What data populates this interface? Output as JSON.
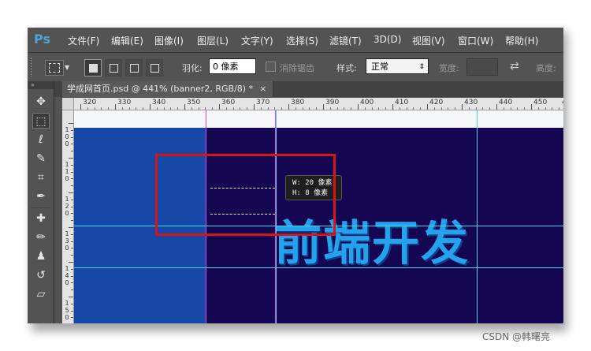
{
  "app": {
    "logo": "Ps"
  },
  "menu": [
    {
      "label": "文件(F)"
    },
    {
      "label": "编辑(E)"
    },
    {
      "label": "图像(I)"
    },
    {
      "label": "图层(L)"
    },
    {
      "label": "文字(Y)"
    },
    {
      "label": "选择(S)"
    },
    {
      "label": "滤镜(T)"
    },
    {
      "label": "3D(D)"
    },
    {
      "label": "视图(V)"
    },
    {
      "label": "窗口(W)"
    },
    {
      "label": "帮助(H)"
    }
  ],
  "options": {
    "feather_label": "羽化:",
    "feather_value": "0 像素",
    "antialias_label": "消除锯齿",
    "style_label": "样式:",
    "style_value": "正常",
    "width_label": "宽度:",
    "height_label": "高度:"
  },
  "document": {
    "tab_title": "学成网首页.psd @ 441% (banner2, RGB/8) *",
    "close_glyph": "×"
  },
  "ruler": {
    "top_labels": [
      "320",
      "330",
      "340",
      "350",
      "360",
      "370",
      "380",
      "390",
      "400",
      "410",
      "420",
      "430",
      "440",
      "450",
      "460"
    ],
    "left_labels": [
      "1 0 0",
      "1 1 0",
      "1 2 0",
      "1 3 0",
      "1 4 0",
      "1 5 0"
    ]
  },
  "selection_info": {
    "width": "W: 20 像素",
    "height": "H:  8 像素"
  },
  "canvas": {
    "headline": "前端开发",
    "colors": {
      "background": "#150652",
      "blue_block": "#1648a8",
      "guide_cyan": "#4ed4e8",
      "guide_magenta": "#e040e8",
      "headline": "#26a2ec",
      "annotation_red": "#d81414"
    }
  },
  "watermark": "CSDN @韩曙亮"
}
